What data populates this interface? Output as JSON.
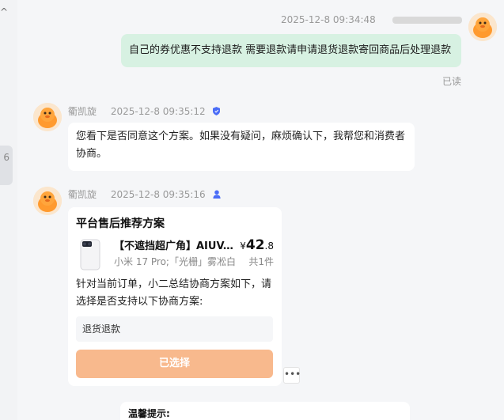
{
  "sidebar": {
    "caret": "^",
    "tab_text": "6"
  },
  "messages": {
    "outgoing": {
      "timestamp": "2025-12-8 09:34:48",
      "text": "自己的券优惠不支持退款  需要退款请申请退货退款寄回商品后处理退款",
      "read_status": "已读"
    },
    "agent_msg_1": {
      "sender": "衢凯旋",
      "timestamp": "2025-12-8 09:35:12",
      "badge_icon": "shield-icon",
      "text": "您看下是否同意这个方案。如果没有疑问，麻烦确认下，我帮您和消费者协商。"
    },
    "agent_msg_2": {
      "sender": "衢凯旋",
      "timestamp": "2025-12-8 09:35:16",
      "badge_icon": "person-icon"
    }
  },
  "card": {
    "title": "平台售后推荐方案",
    "product_name": "【不遮挡超广角】AIUV...",
    "product_spec": "小米 17 Pro;「光栅」雾凇白",
    "price_symbol": "¥",
    "price_int": "42",
    "price_dec": ".8",
    "count": "共1件",
    "description": "针对当前订单，小二总结协商方案如下，请选择是否支持以下协商方案:",
    "option": "退货退款",
    "selected_label": "已选择"
  },
  "more_label": "•••",
  "tip": {
    "title": "温馨提示:"
  },
  "colors": {
    "outgoing_bubble": "#d7f1e2",
    "primary_button": "#f8b98d",
    "badge_blue": "#4a6cf7"
  }
}
